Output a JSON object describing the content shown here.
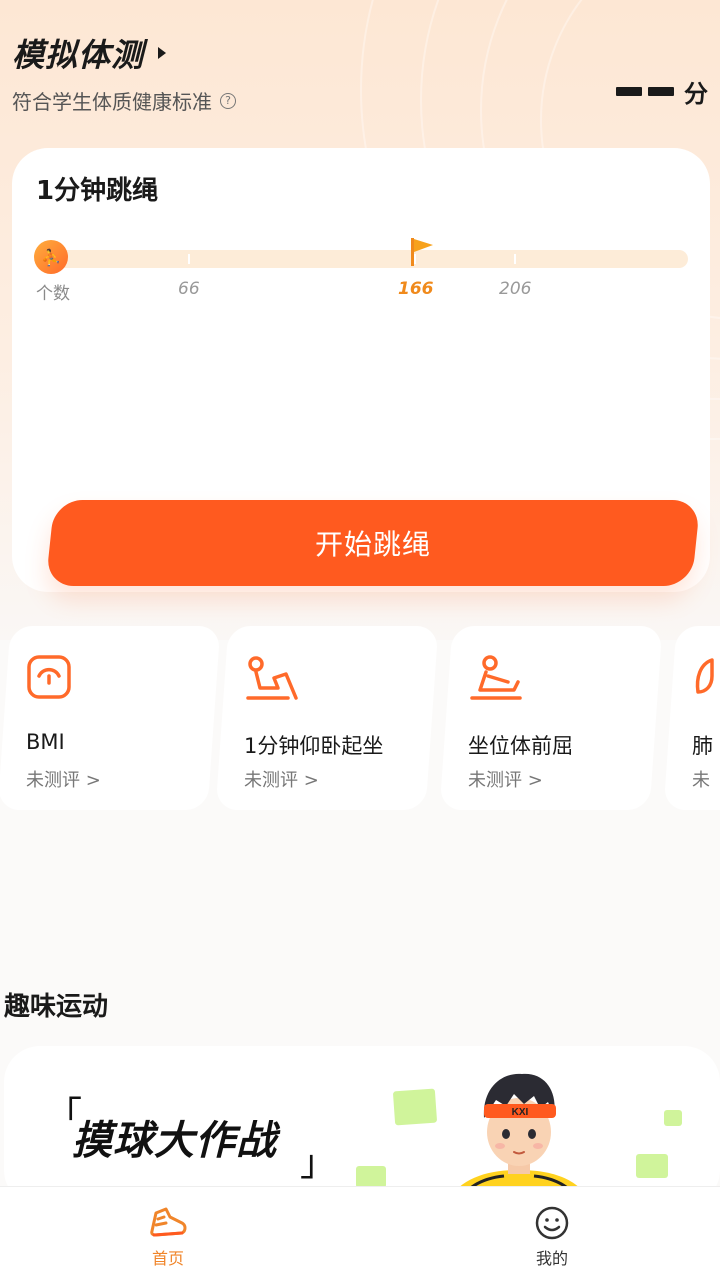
{
  "header": {
    "title": "模拟体测",
    "subtitle": "符合学生体质健康标准",
    "score_unit": "分"
  },
  "main_card": {
    "title": "1分钟跳绳",
    "progress": {
      "axis_label": "个数",
      "ticks": [
        "66",
        "166",
        "206"
      ],
      "goal": "166"
    },
    "start_button": "开始跳绳"
  },
  "tests": [
    {
      "name": "BMI",
      "status": "未测评 >",
      "icon": "bmi-scale-icon"
    },
    {
      "name": "1分钟仰卧起坐",
      "status": "未测评 >",
      "icon": "situp-icon"
    },
    {
      "name": "坐位体前屈",
      "status": "未测评 >",
      "icon": "sit-reach-icon"
    },
    {
      "name": "肺",
      "status": "未",
      "icon": "lung-icon"
    }
  ],
  "fun_section": {
    "title": "趣味运动",
    "game": {
      "title": "摸球大作战",
      "bracket_open": "「",
      "bracket_close": "」",
      "mascot_headband": "KXI"
    }
  },
  "tabbar": {
    "home": "首页",
    "mine": "我的"
  },
  "colors": {
    "accent": "#ff5a1f",
    "accent_orange": "#f0852a",
    "goal_text": "#f08a1c"
  }
}
